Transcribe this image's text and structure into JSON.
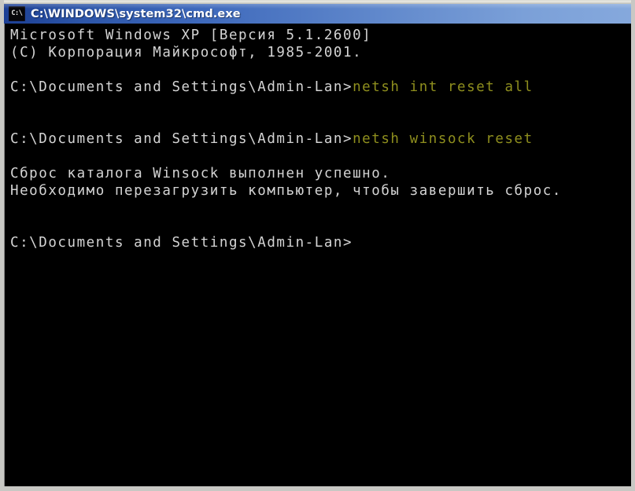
{
  "window": {
    "title": "C:\\WINDOWS\\system32\\cmd.exe",
    "system_icon": "cmd-console-icon",
    "icon_glyph": "C:\\",
    "titlebar_color_left": "#1c3f94",
    "titlebar_color_right": "#86a9dd",
    "frame_color": "#c8c8c4",
    "console_background": "#000000",
    "console_foreground": "#d4d4d4",
    "command_color": "#8f8f1e"
  },
  "console": {
    "lines": [
      {
        "id": "banner-version",
        "segments": [
          {
            "text": "Microsoft Windows XP [Версия 5.1.2600]",
            "kind": "out"
          }
        ]
      },
      {
        "id": "banner-copyright",
        "segments": [
          {
            "text": "(C) Корпорация Майкрософт, 1985-2001.",
            "kind": "out"
          }
        ]
      },
      {
        "id": "blank-1",
        "segments": [
          {
            "text": " ",
            "kind": "out"
          }
        ]
      },
      {
        "id": "prompt-command-1",
        "segments": [
          {
            "text": "C:\\Documents and Settings\\Admin-Lan>",
            "kind": "out"
          },
          {
            "text": "netsh int reset all",
            "kind": "cmd"
          }
        ]
      },
      {
        "id": "blank-2",
        "segments": [
          {
            "text": " ",
            "kind": "out"
          }
        ]
      },
      {
        "id": "blank-3",
        "segments": [
          {
            "text": " ",
            "kind": "out"
          }
        ]
      },
      {
        "id": "prompt-command-2",
        "segments": [
          {
            "text": "C:\\Documents and Settings\\Admin-Lan>",
            "kind": "out"
          },
          {
            "text": "netsh winsock reset",
            "kind": "cmd"
          }
        ]
      },
      {
        "id": "blank-4",
        "segments": [
          {
            "text": " ",
            "kind": "out"
          }
        ]
      },
      {
        "id": "output-winsock-success",
        "segments": [
          {
            "text": "Сброс каталога Winsock выполнен успешно.",
            "kind": "out"
          }
        ]
      },
      {
        "id": "output-reboot-required",
        "segments": [
          {
            "text": "Необходимо перезагрузить компьютер, чтобы завершить сброс.",
            "kind": "out"
          }
        ]
      },
      {
        "id": "blank-5",
        "segments": [
          {
            "text": " ",
            "kind": "out"
          }
        ]
      },
      {
        "id": "blank-6",
        "segments": [
          {
            "text": " ",
            "kind": "out"
          }
        ]
      },
      {
        "id": "prompt-current",
        "segments": [
          {
            "text": "C:\\Documents and Settings\\Admin-Lan>",
            "kind": "out"
          }
        ]
      }
    ]
  }
}
